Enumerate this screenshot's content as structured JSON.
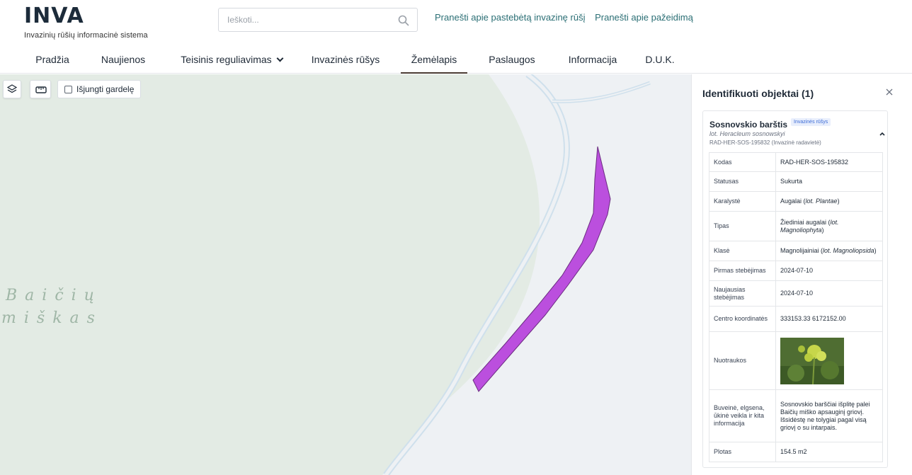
{
  "brand": {
    "logo": "INVA",
    "subtitle": "Invazinių rūšių informacinė sistema"
  },
  "search": {
    "placeholder": "Ieškoti..."
  },
  "top_links": [
    "Pranešti apie pastebėtą invazinę rūšį",
    "Pranešti apie pažeidimą"
  ],
  "nav": [
    {
      "label": "Pradžia"
    },
    {
      "label": "Naujienos"
    },
    {
      "label": "Teisinis reguliavimas",
      "dropdown": true
    },
    {
      "label": "Invazinės rūšys"
    },
    {
      "label": "Žemėlapis",
      "active": true
    },
    {
      "label": "Paslaugos"
    },
    {
      "label": "Informacija"
    },
    {
      "label": "D.U.K."
    }
  ],
  "map": {
    "grid_toggle_label": "Išjungti gardelę",
    "grid_toggle_checked": false,
    "place_label_line1": "Baičių",
    "place_label_line2": "miškas",
    "colors": {
      "forest": "#e3ebe4",
      "open_land": "#eef1f4",
      "ditch": "#c8dcea",
      "feature": "#bb4fde",
      "feature_stroke": "#6b2d80"
    }
  },
  "panel": {
    "title": "Identifikuoti objektai (1)",
    "object": {
      "name": "Sosnovskio barštis",
      "badge": "Invazinės rūšys",
      "latin": "lot. Heracleum sosnowskyi",
      "code_line": "RAD-HER-SOS-195832 (Invazinė radavietė)",
      "attributes": [
        {
          "key": "Kodas",
          "value": "RAD-HER-SOS-195832"
        },
        {
          "key": "Statusas",
          "value": "Sukurta"
        },
        {
          "key": "Karalystė",
          "value": "Augalai (lot. Plantae)"
        },
        {
          "key": "Tipas",
          "value": "Žiediniai augalai (lot. Magnoliophyta)"
        },
        {
          "key": "Klasė",
          "value": "Magnolijainiai (lot. Magnoliopsida)"
        },
        {
          "key": "Pirmas stebėjimas",
          "value": "2024-07-10"
        },
        {
          "key": "Naujausias stebėjimas",
          "value": "2024-07-10"
        },
        {
          "key": "Centro koordinatės",
          "value": "333153.33 6172152.00"
        },
        {
          "key": "Nuotraukos",
          "value": ""
        },
        {
          "key": "Buveinė, elgsena, ūkinė veikla ir kita informacija",
          "value": "Sosnovskio barščiai išplitę palei Baičių miško apsauginį griovį. Išsidėstę ne tolygiai pagal visą griovį o su intarpais."
        },
        {
          "key": "Plotas",
          "value": "154.5 m2"
        }
      ]
    }
  },
  "accent": "#2a6e74"
}
